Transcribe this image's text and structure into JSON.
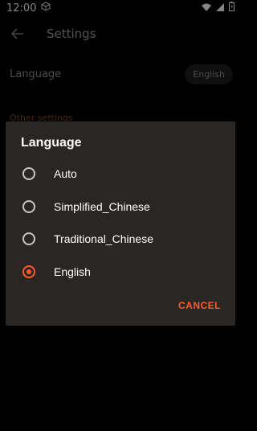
{
  "status_bar": {
    "time": "12:00"
  },
  "app_bar": {
    "title": "Settings"
  },
  "settings": {
    "language_label": "Language",
    "language_value": "English",
    "other_settings_header": "Other settings"
  },
  "dialog": {
    "title": "Language",
    "options": [
      {
        "label": "Auto",
        "selected": false
      },
      {
        "label": "Simplified_Chinese",
        "selected": false
      },
      {
        "label": "Traditional_Chinese",
        "selected": false
      },
      {
        "label": "English",
        "selected": true
      }
    ],
    "cancel_label": "CANCEL"
  },
  "colors": {
    "accent": "#ff5a2a",
    "dialog_bg": "#2a2624",
    "page_bg": "#000000"
  },
  "icons": {
    "back": "arrow-left-icon",
    "box": "cube-icon",
    "wifi": "wifi-icon",
    "signal": "signal-icon",
    "battery": "battery-icon"
  }
}
